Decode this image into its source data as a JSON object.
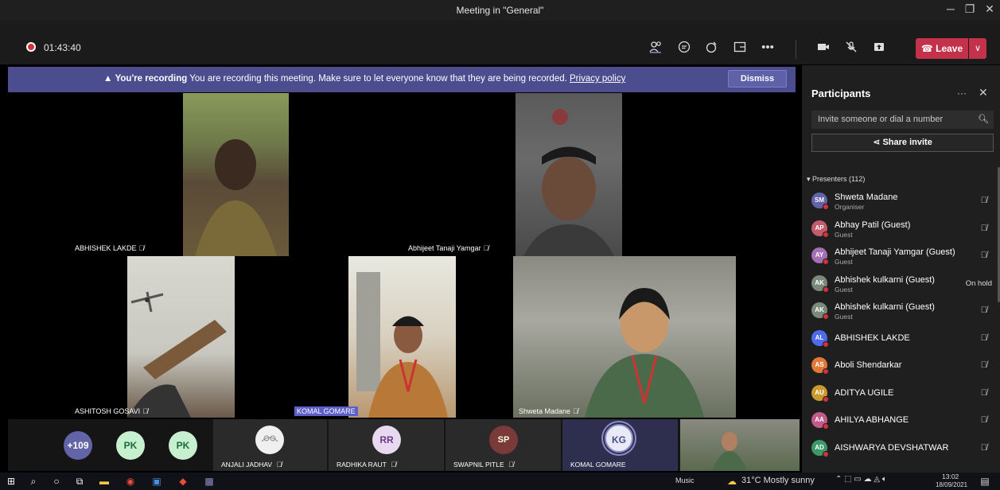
{
  "window": {
    "title": "Meeting in \"General\""
  },
  "toolbar": {
    "timer": "01:43:40",
    "leave_label": "Leave"
  },
  "banner": {
    "bold": "You're recording",
    "text": " You are recording this meeting. Make sure to let everyone know that they are being recorded. ",
    "link": "Privacy policy",
    "dismiss": "Dismiss"
  },
  "tiles": [
    {
      "name": "ABHISHEK LAKDE"
    },
    {
      "name": "Abhijeet Tanaji Yamgar"
    },
    {
      "name": "ASHITOSH GOSAVI"
    },
    {
      "name": "KOMAL GOMARE"
    },
    {
      "name": "Shweta Madane"
    }
  ],
  "strip": {
    "overflow_count": "+109",
    "avatars": [
      {
        "initials": "PK"
      },
      {
        "initials": "PK"
      }
    ],
    "tiles": [
      {
        "name": "ANJALI JADHAV"
      },
      {
        "name": "RADHIKA RAUT",
        "initials": "RR"
      },
      {
        "name": "SWAPNIL PITLE",
        "initials": "SP"
      },
      {
        "name": "KOMAL GOMARE",
        "initials": "KG"
      }
    ]
  },
  "panel": {
    "title": "Participants",
    "invite_placeholder": "Invite someone or dial a number",
    "share_label": "Share invite",
    "presenters_label": "Presenters (112)",
    "participants": [
      {
        "initials": "SM",
        "name": "Shweta Madane",
        "role": "Organiser",
        "color": "#6264a7"
      },
      {
        "initials": "AP",
        "name": "Abhay Patil (Guest)",
        "role": "Guest",
        "color": "#c25b6b"
      },
      {
        "initials": "AY",
        "name": "Abhijeet Tanaji Yamgar (Guest)",
        "role": "Guest",
        "color": "#a56fb5"
      },
      {
        "initials": "AK",
        "name": "Abhishek kulkarni (Guest)",
        "role": "Guest",
        "color": "#7a8a7a",
        "status": "On hold"
      },
      {
        "initials": "AK",
        "name": "Abhishek kulkarni (Guest)",
        "role": "Guest",
        "color": "#7a8a7a"
      },
      {
        "initials": "AL",
        "name": "ABHISHEK LAKDE",
        "role": "",
        "color": "#4f6bed"
      },
      {
        "initials": "AS",
        "name": "Aboli Shendarkar",
        "role": "",
        "color": "#e07a3a"
      },
      {
        "initials": "AU",
        "name": "ADITYA UGILE",
        "role": "",
        "color": "#c99a2e"
      },
      {
        "initials": "AA",
        "name": "AHILYA ABHANGE",
        "role": "",
        "color": "#c25b8b"
      },
      {
        "initials": "AD",
        "name": "AISHWARYA DEVSHATWAR",
        "role": "",
        "color": "#3a9a6a"
      }
    ]
  },
  "taskbar": {
    "music": "Music",
    "weather": "31°C  Mostly sunny",
    "time": "13:02",
    "date": "18/09/2021"
  },
  "colors": {
    "accent": "#6264a7",
    "banner": "#4b4d8f",
    "leave": "#c4314b"
  }
}
